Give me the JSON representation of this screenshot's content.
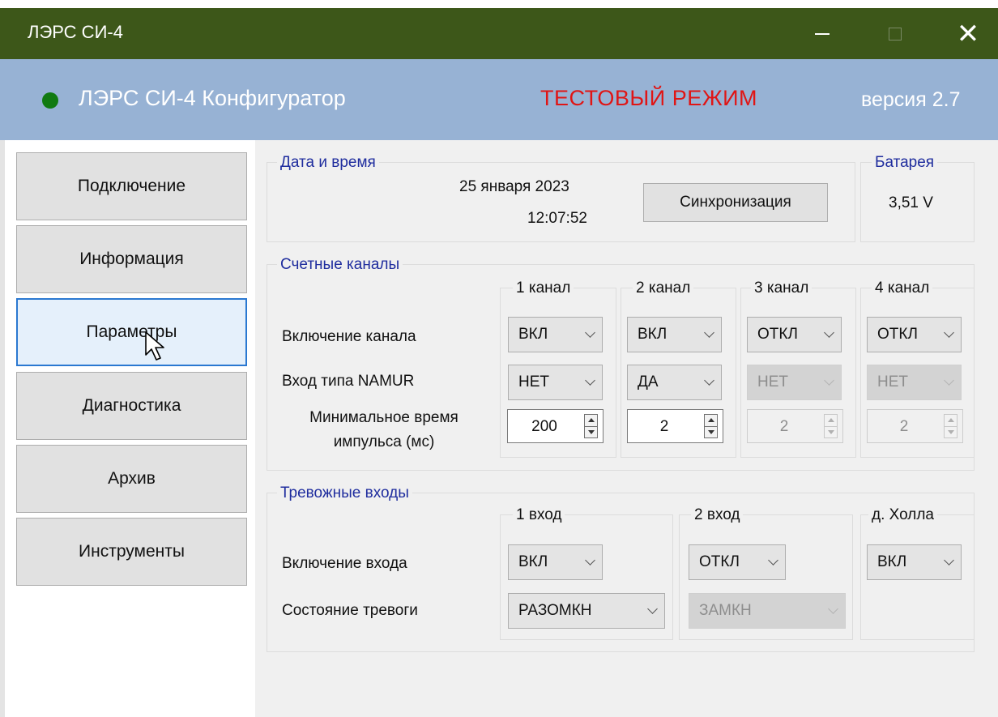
{
  "window": {
    "title": "ЛЭРС СИ-4"
  },
  "header": {
    "app_name": "ЛЭРС СИ-4 Конфигуратор",
    "mode": "ТЕСТОВЫЙ  РЕЖИМ",
    "version": "версия 2.7",
    "colors": {
      "bar": "#97b2d4",
      "mode_text": "#e01515",
      "status_led": "#117a11",
      "titlebar": "#3d5719"
    }
  },
  "sidebar": {
    "items": [
      {
        "label": "Подключение"
      },
      {
        "label": "Информация"
      },
      {
        "label": "Параметры",
        "active": true
      },
      {
        "label": "Диагностика"
      },
      {
        "label": "Архив"
      },
      {
        "label": "Инструменты"
      }
    ]
  },
  "datetime": {
    "title": "Дата и время",
    "date": "25 января 2023",
    "time": "12:07:52",
    "sync_label": "Синхронизация"
  },
  "battery": {
    "title": "Батарея",
    "value": "3,51 V"
  },
  "channels": {
    "title": "Счетные каналы",
    "row_labels": {
      "enable": "Включение канала",
      "namur": "Вход типа NAMUR",
      "min_time_line1": "Минимальное время",
      "min_time_line2": "импульса (мс)"
    },
    "items": [
      {
        "name": "1 канал",
        "enable": "ВКЛ",
        "namur": "НЕТ",
        "min_time": "200"
      },
      {
        "name": "2 канал",
        "enable": "ВКЛ",
        "namur": "ДА",
        "min_time": "2"
      },
      {
        "name": "3 канал",
        "enable": "ОТКЛ",
        "namur": "НЕТ",
        "min_time": "2"
      },
      {
        "name": "4 канал",
        "enable": "ОТКЛ",
        "namur": "НЕТ",
        "min_time": "2"
      }
    ]
  },
  "alarms": {
    "title": "Тревожные входы",
    "row_labels": {
      "enable": "Включение входа",
      "state": "Состояние тревоги"
    },
    "items": [
      {
        "name": "1 вход",
        "enable": "ВКЛ",
        "state": "РАЗОМКН"
      },
      {
        "name": "2 вход",
        "enable": "ОТКЛ",
        "state": "ЗАМКН"
      },
      {
        "name": "д. Холла",
        "enable": "ВКЛ"
      }
    ]
  }
}
